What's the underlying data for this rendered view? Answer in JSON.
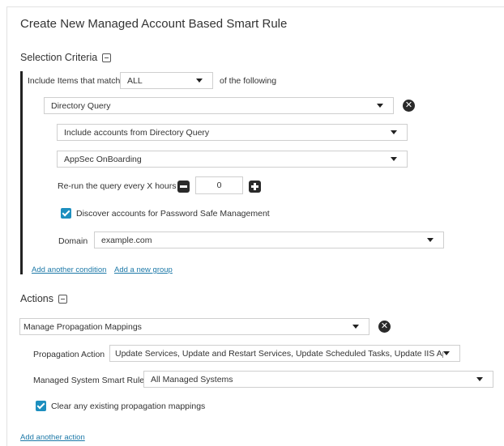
{
  "title": "Create New Managed Account Based Smart Rule",
  "selection_criteria": {
    "heading": "Selection Criteria",
    "include_label": "Include Items that match",
    "match_value": "ALL",
    "of_following": "of the following",
    "condition": {
      "type_value": "Directory Query",
      "include_accounts_value": "Include accounts from Directory Query",
      "query_value": "AppSec OnBoarding",
      "rerun_label": "Re-run the query every X hours",
      "rerun_hours": "0",
      "discover_label": "Discover accounts for Password Safe Management",
      "discover_checked": true,
      "domain_label": "Domain",
      "domain_value": "example.com"
    },
    "add_condition_link": "Add another condition",
    "add_group_link": "Add a new group"
  },
  "actions": {
    "heading": "Actions",
    "action_type_value": "Manage Propagation Mappings",
    "propagation_action_label": "Propagation Action",
    "propagation_action_value": "Update Services, Update and Restart Services, Update Scheduled Tasks, Update IIS Applic...",
    "smart_rule_label": "Managed System Smart Rule",
    "smart_rule_value": "All Managed Systems",
    "clear_label": "Clear any existing propagation mappings",
    "clear_checked": true,
    "add_action_link": "Add another action"
  },
  "colors": {
    "accent": "#1d8fbf",
    "link": "#1d79a8",
    "dark_button": "#2a2a2a"
  }
}
